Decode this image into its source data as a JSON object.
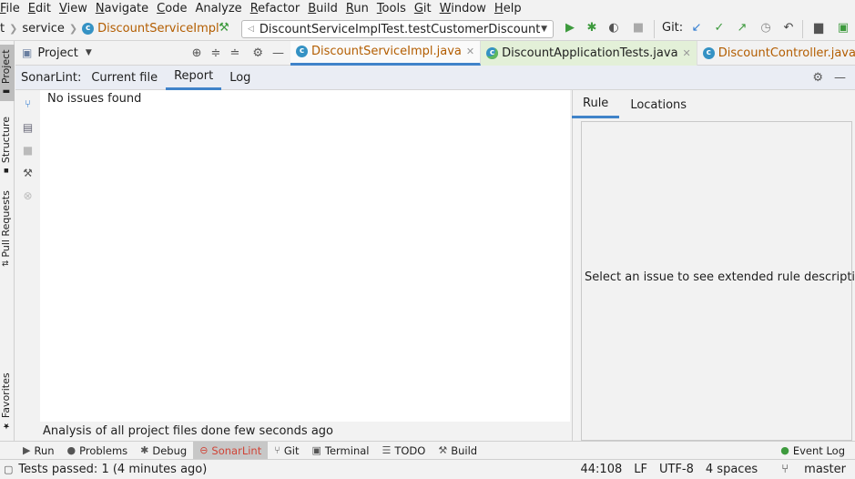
{
  "menu": [
    {
      "label": "File",
      "u": "F",
      "rest": "ile"
    },
    {
      "label": "Edit",
      "u": "E",
      "rest": "dit"
    },
    {
      "label": "View",
      "u": "V",
      "rest": "iew"
    },
    {
      "label": "Navigate",
      "u": "N",
      "rest": "avigate"
    },
    {
      "label": "Code",
      "u": "C",
      "rest": "ode"
    },
    {
      "label": "Analyze",
      "u": "",
      "rest": "Analyze"
    },
    {
      "label": "Refactor",
      "u": "R",
      "rest": "efactor"
    },
    {
      "label": "Build",
      "u": "B",
      "rest": "uild"
    },
    {
      "label": "Run",
      "u": "R",
      "rest": "un"
    },
    {
      "label": "Tools",
      "u": "T",
      "rest": "ools"
    },
    {
      "label": "Git",
      "u": "G",
      "rest": "it"
    },
    {
      "label": "Window",
      "u": "W",
      "rest": "indow"
    },
    {
      "label": "Help",
      "u": "H",
      "rest": "elp"
    }
  ],
  "breadcrumb": {
    "prev": "t",
    "folder": "service",
    "file": "DiscountServiceImpl"
  },
  "run_config": "DiscountServiceImplTest.testCustomerDiscount",
  "git_label": "Git:",
  "left_strip": {
    "project": "Project",
    "structure": "Structure",
    "pull_requests": "Pull Requests",
    "favorites": "Favorites"
  },
  "project_panel": {
    "title": "Project"
  },
  "editor_tabs": [
    {
      "label": "DiscountServiceImpl.java",
      "state": "active"
    },
    {
      "label": "DiscountApplicationTests.java",
      "state": "test"
    },
    {
      "label": "DiscountController.java",
      "state": "normal"
    }
  ],
  "sonarlint": {
    "label": "SonarLint:",
    "tabs": [
      "Current file",
      "Report",
      "Log"
    ],
    "active_tab": "Report",
    "result": "No issues found",
    "status_message": "Analysis of all project files done few seconds ago",
    "rule_tabs": [
      "Rule",
      "Locations"
    ],
    "rule_placeholder": "Select an issue to see extended rule description"
  },
  "bottom_tools": [
    {
      "label": "Run",
      "icon": "run-icon"
    },
    {
      "label": "Problems",
      "icon": "problems-icon"
    },
    {
      "label": "Debug",
      "icon": "debug-icon"
    },
    {
      "label": "SonarLint",
      "icon": "sonarlint-icon"
    },
    {
      "label": "Git",
      "icon": "git-icon"
    },
    {
      "label": "Terminal",
      "icon": "terminal-icon"
    },
    {
      "label": "TODO",
      "icon": "todo-icon"
    },
    {
      "label": "Build",
      "icon": "build-icon"
    }
  ],
  "event_log": "Event Log",
  "status": {
    "message": "Tests passed: 1 (4 minutes ago)",
    "position": "44:108",
    "line_sep": "LF",
    "encoding": "UTF-8",
    "indent": "4 spaces",
    "branch": "master"
  },
  "colors": {
    "accent": "#4083c9",
    "run_green": "#3d9a3d",
    "sonar_red": "#d04437",
    "file_orange": "#b35d00"
  }
}
